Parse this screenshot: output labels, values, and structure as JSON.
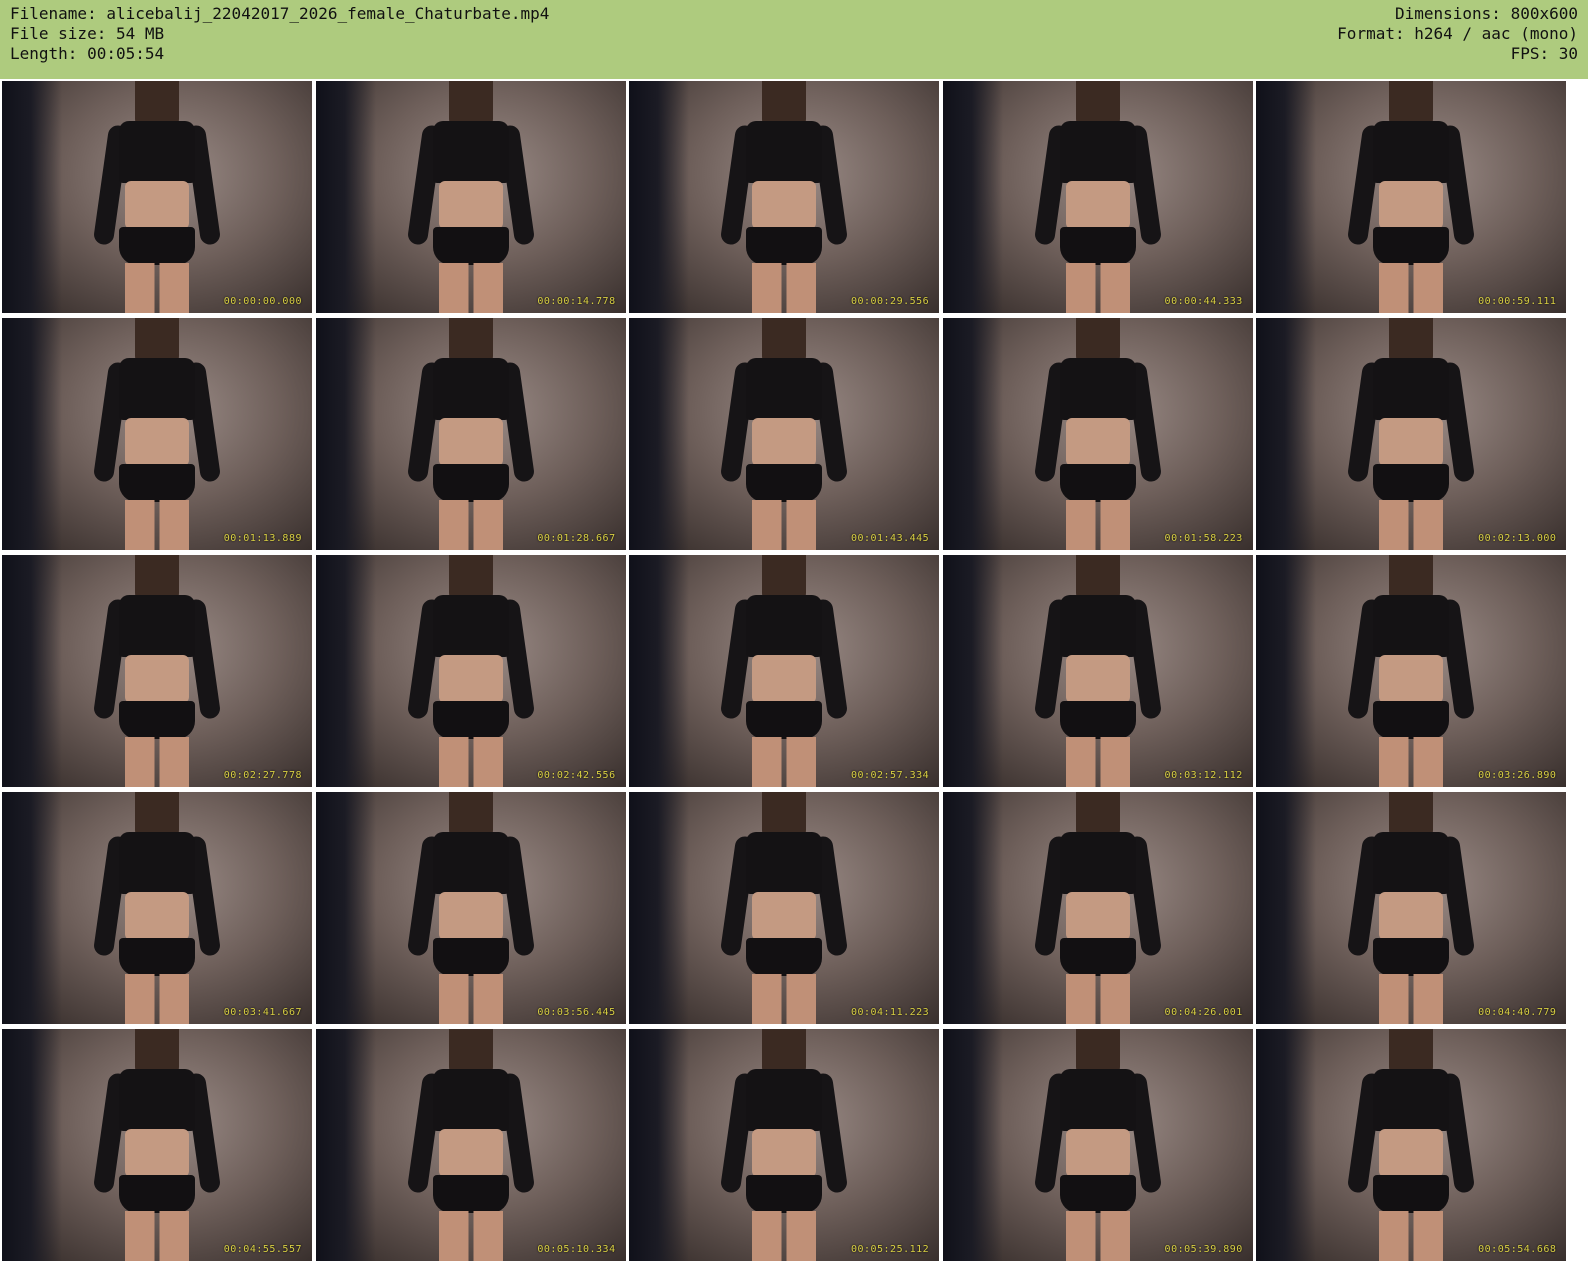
{
  "header": {
    "filename": "Filename: alicebalij_22042017_2026_female_Chaturbate.mp4",
    "file_size": "File size: 54 MB",
    "length": "Length: 00:05:54",
    "dimensions": "Dimensions: 800x600",
    "format": "Format: h264 / aac (mono)",
    "fps": "FPS: 30"
  },
  "colors": {
    "header_bg": "#aecb7e",
    "timestamp": "#d8cf42"
  },
  "thumbnails": [
    {
      "timestamp": "00:00:00.000"
    },
    {
      "timestamp": "00:00:14.778"
    },
    {
      "timestamp": "00:00:29.556"
    },
    {
      "timestamp": "00:00:44.333"
    },
    {
      "timestamp": "00:00:59.111"
    },
    {
      "timestamp": "00:01:13.889"
    },
    {
      "timestamp": "00:01:28.667"
    },
    {
      "timestamp": "00:01:43.445"
    },
    {
      "timestamp": "00:01:58.223"
    },
    {
      "timestamp": "00:02:13.000"
    },
    {
      "timestamp": "00:02:27.778"
    },
    {
      "timestamp": "00:02:42.556"
    },
    {
      "timestamp": "00:02:57.334"
    },
    {
      "timestamp": "00:03:12.112"
    },
    {
      "timestamp": "00:03:26.890"
    },
    {
      "timestamp": "00:03:41.667"
    },
    {
      "timestamp": "00:03:56.445"
    },
    {
      "timestamp": "00:04:11.223"
    },
    {
      "timestamp": "00:04:26.001"
    },
    {
      "timestamp": "00:04:40.779"
    },
    {
      "timestamp": "00:04:55.557"
    },
    {
      "timestamp": "00:05:10.334"
    },
    {
      "timestamp": "00:05:25.112"
    },
    {
      "timestamp": "00:05:39.890"
    },
    {
      "timestamp": "00:05:54.668"
    }
  ]
}
